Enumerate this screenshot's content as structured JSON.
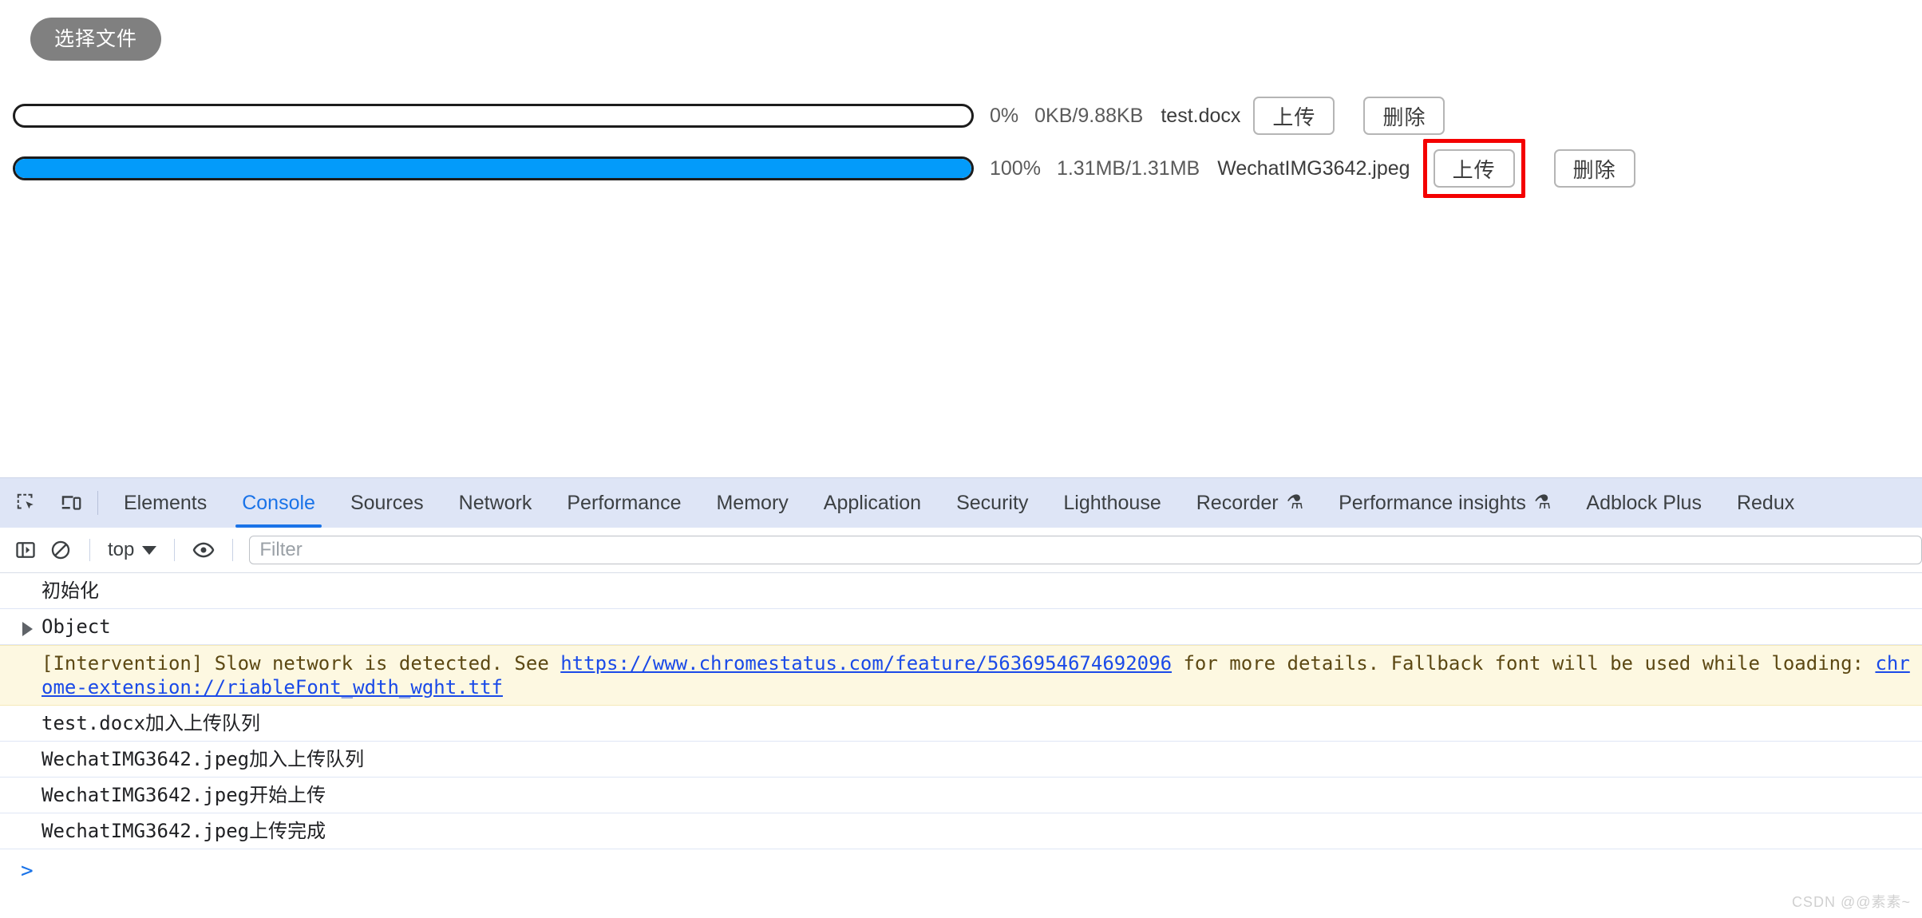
{
  "page": {
    "choose_file_button": "选择文件",
    "uploads": [
      {
        "percent_label": "0%",
        "percent_value": 0,
        "size_label": "0KB/9.88KB",
        "file_name": "test.docx",
        "upload_button": "上传",
        "delete_button": "删除",
        "highlighted": false
      },
      {
        "percent_label": "100%",
        "percent_value": 100,
        "size_label": "1.31MB/1.31MB",
        "file_name": "WechatIMG3642.jpeg",
        "upload_button": "上传",
        "delete_button": "删除",
        "highlighted": true
      }
    ],
    "colors": {
      "choose_button_bg": "#808080",
      "progress_fill": "#039bfa",
      "progress_border": "#1c1c1c",
      "highlight_border": "#f40000"
    }
  },
  "devtools": {
    "inspect_icon": "inspect-element-icon",
    "device_icon": "device-toolbar-icon",
    "tabs": [
      {
        "label": "Elements",
        "active": false,
        "experimental": false
      },
      {
        "label": "Console",
        "active": true,
        "experimental": false
      },
      {
        "label": "Sources",
        "active": false,
        "experimental": false
      },
      {
        "label": "Network",
        "active": false,
        "experimental": false
      },
      {
        "label": "Performance",
        "active": false,
        "experimental": false
      },
      {
        "label": "Memory",
        "active": false,
        "experimental": false
      },
      {
        "label": "Application",
        "active": false,
        "experimental": false
      },
      {
        "label": "Security",
        "active": false,
        "experimental": false
      },
      {
        "label": "Lighthouse",
        "active": false,
        "experimental": false
      },
      {
        "label": "Recorder",
        "active": false,
        "experimental": true
      },
      {
        "label": "Performance insights",
        "active": false,
        "experimental": true
      },
      {
        "label": "Adblock Plus",
        "active": false,
        "experimental": false
      },
      {
        "label": "Redux",
        "active": false,
        "experimental": false
      }
    ],
    "active_tab_color": "#1a73e8",
    "toolbar": {
      "sidebar_toggle_icon": "console-sidebar-icon",
      "clear_console_icon": "clear-console-icon",
      "context_label": "top",
      "eye_icon": "live-expression-icon",
      "filter_placeholder": "Filter",
      "filter_value": ""
    },
    "console": {
      "messages": [
        {
          "type": "log",
          "text": "初始化"
        },
        {
          "type": "object",
          "text": "Object"
        },
        {
          "type": "warning",
          "prefix": "[Intervention] Slow network is detected. See ",
          "link1": "https://www.chromestatus.com/feature/5636954674692096",
          "middle": " for more details. Fallback font will be used while loading: ",
          "link2": "chrome-extension://riableFont_wdth_wght.ttf"
        },
        {
          "type": "log",
          "text": "test.docx加入上传队列"
        },
        {
          "type": "log",
          "text": "WechatIMG3642.jpeg加入上传队列"
        },
        {
          "type": "log",
          "text": "WechatIMG3642.jpeg开始上传"
        },
        {
          "type": "log",
          "text": "WechatIMG3642.jpeg上传完成"
        }
      ],
      "prompt_symbol": ">"
    }
  },
  "watermark": "CSDN @@素素~"
}
